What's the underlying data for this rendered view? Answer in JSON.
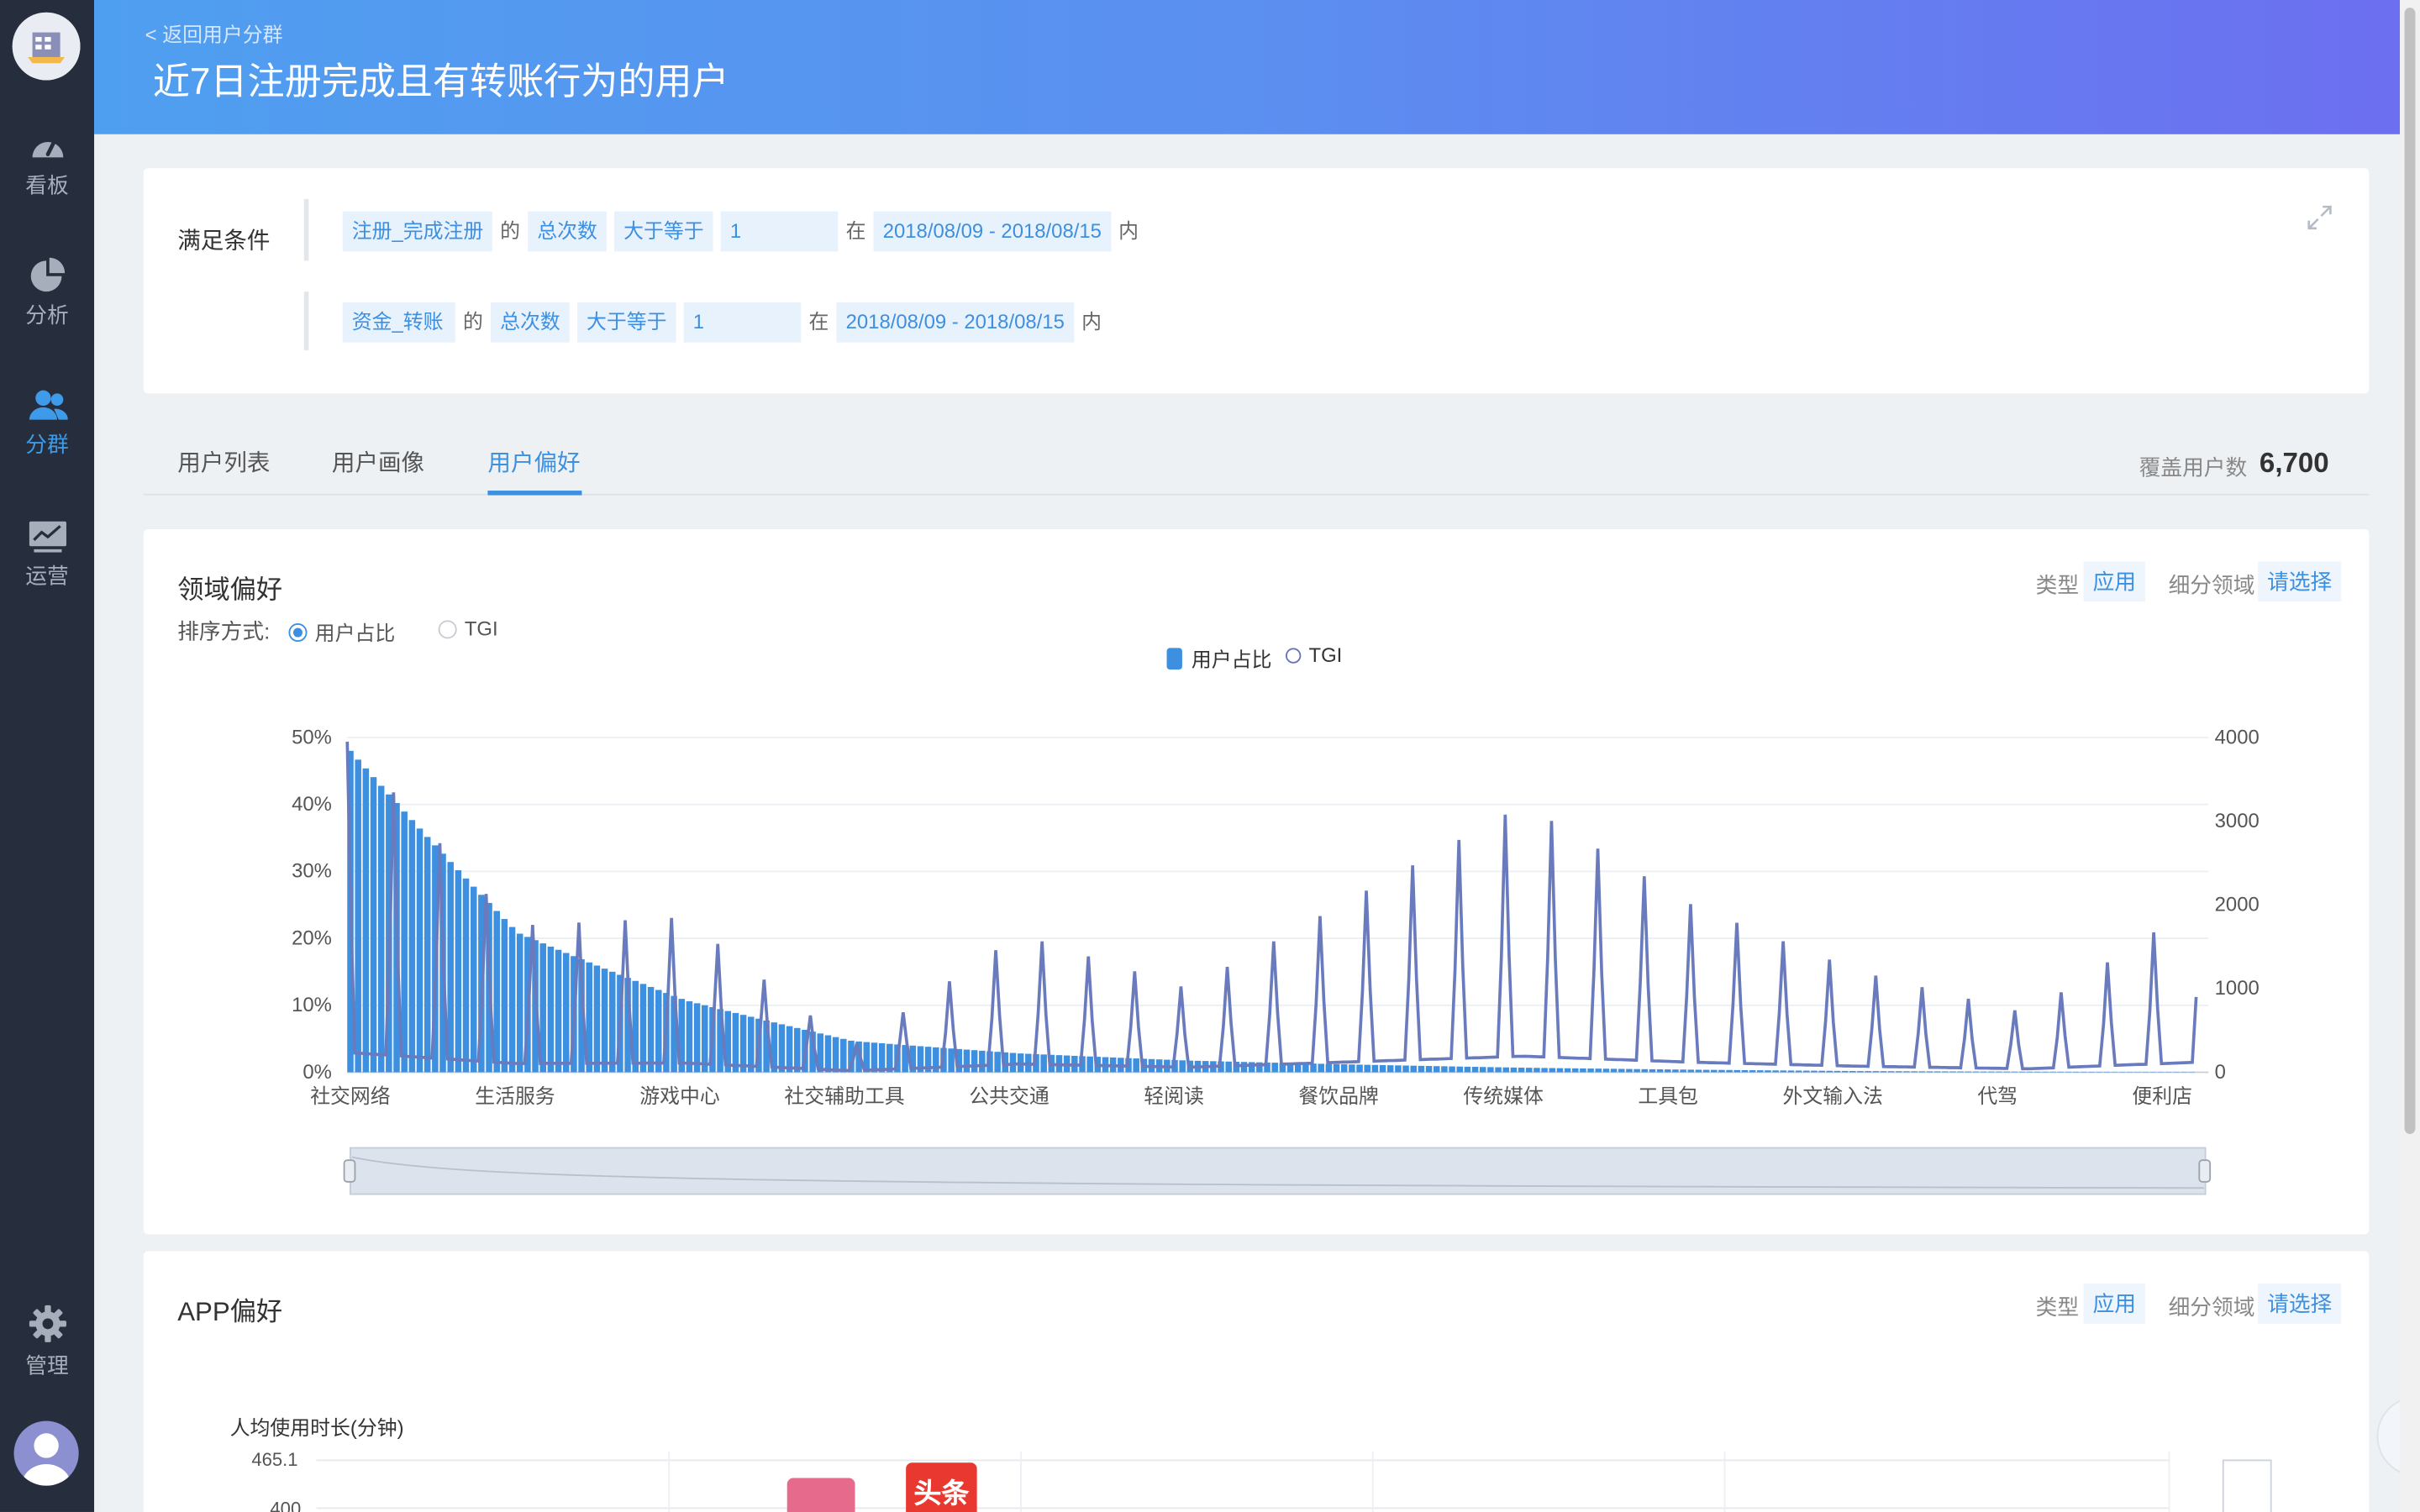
{
  "sidebar": {
    "items": [
      {
        "label": "看板",
        "icon": "dashboard-gauge-icon"
      },
      {
        "label": "分析",
        "icon": "pie-chart-icon"
      },
      {
        "label": "分群",
        "icon": "users-icon",
        "active": true
      },
      {
        "label": "运营",
        "icon": "monitor-chart-icon"
      }
    ],
    "bottom": {
      "label": "管理",
      "icon": "gear-icon"
    }
  },
  "header": {
    "back_label": "< 返回用户分群",
    "title": "近7日注册完成且有转账行为的用户"
  },
  "conditions": {
    "title": "满足条件",
    "rows": [
      {
        "event": "注册_完成注册",
        "of": "的",
        "metric": "总次数",
        "operator": "大于等于",
        "value": "1",
        "in": "在",
        "date_range": "2018/08/09 - 2018/08/15",
        "within": "内"
      },
      {
        "event": "资金_转账",
        "of": "的",
        "metric": "总次数",
        "operator": "大于等于",
        "value": "1",
        "in": "在",
        "date_range": "2018/08/09 - 2018/08/15",
        "within": "内"
      }
    ]
  },
  "tabs": {
    "items": [
      "用户列表",
      "用户画像",
      "用户偏好"
    ],
    "active_index": 2,
    "cover_label": "覆盖用户数",
    "cover_value": "6,700"
  },
  "domain_card": {
    "title": "领域偏好",
    "type_label": "类型",
    "type_value": "应用",
    "sub_label": "细分领域",
    "sub_value": "请选择",
    "sort_label": "排序方式:",
    "sort_options": [
      "用户占比",
      "TGI"
    ],
    "sort_selected": 0,
    "legend": [
      "用户占比",
      "TGI"
    ]
  },
  "chart_data": {
    "type": "bar",
    "categories": [
      "社交网络",
      "生活服务",
      "游戏中心",
      "社交辅助工具",
      "公共交通",
      "轻阅读",
      "餐饮品牌",
      "传统媒体",
      "工具包",
      "外文输入法",
      "代驾",
      "便利店"
    ],
    "series": [
      {
        "name": "用户占比",
        "type": "bar",
        "axis": "left",
        "values": [
          48,
          22,
          12,
          5.5,
          3.5,
          2.3,
          1.6,
          1.0,
          0.6,
          0.3,
          0.15,
          0.05
        ]
      },
      {
        "name": "TGI",
        "type": "line",
        "axis": "right",
        "values": [
          3950,
          1750,
          1850,
          300,
          1650,
          1000,
          2100,
          3200,
          2000,
          1200,
          700,
          2000
        ]
      }
    ],
    "y_left": {
      "ticks": [
        "0%",
        "10%",
        "20%",
        "30%",
        "40%",
        "50%"
      ],
      "range": [
        0,
        50
      ]
    },
    "y_right": {
      "ticks": [
        "0",
        "1000",
        "2000",
        "3000",
        "4000"
      ],
      "range": [
        0,
        4000
      ]
    },
    "legend_position": "top-center",
    "grid": true
  },
  "app_card": {
    "title": "APP偏好",
    "type_label": "类型",
    "type_value": "应用",
    "sub_label": "细分领域",
    "sub_value": "请选择",
    "y_label": "人均使用时长(分钟)",
    "y_ticks": [
      "465.1",
      "400"
    ],
    "app_icons": [
      {
        "name": "pink-app-icon",
        "text": "",
        "color": "#e56a8c"
      },
      {
        "name": "toutiao-app-icon",
        "text": "头条",
        "color": "#e8382f"
      }
    ]
  }
}
